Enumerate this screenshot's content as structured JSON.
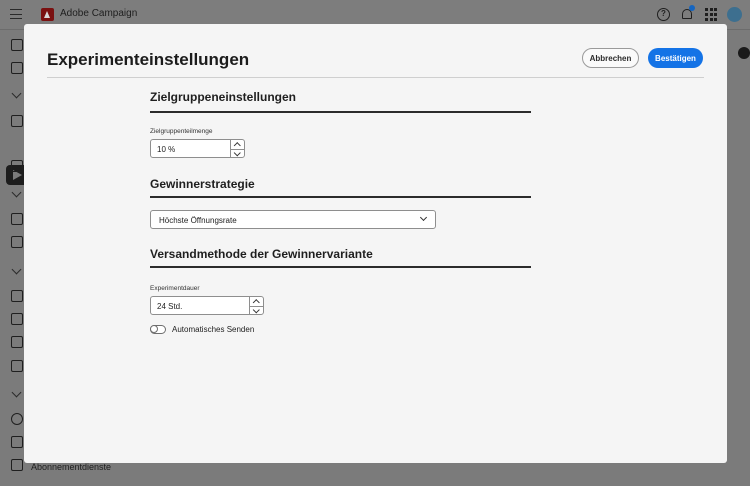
{
  "app": {
    "title": "Adobe Campaign"
  },
  "background": {
    "sidebar_last_item": "Abonnementdienste"
  },
  "modal": {
    "title": "Experimenteinstellungen",
    "cancel_label": "Abbrechen",
    "confirm_label": "Bestätigen",
    "sections": {
      "audience": {
        "title": "Zielgruppeneinstellungen",
        "field_label": "Zielgruppenteilmenge",
        "field_value": "10 %"
      },
      "winner": {
        "title": "Gewinnerstrategie",
        "dropdown_value": "Höchste Öffnungsrate"
      },
      "delivery": {
        "title": "Versandmethode der Gewinnervariante",
        "field_label": "Experimentdauer",
        "field_value": "24 Std.",
        "toggle_label": "Automatisches Senden",
        "toggle_on": false
      }
    }
  },
  "colors": {
    "accent": "#1473e6",
    "overlay": "#7b7b7b",
    "logo": "#7a1010"
  },
  "icons": [
    "menu-icon",
    "adobe-logo-icon",
    "help-icon",
    "notification-bell-icon",
    "app-switcher-icon",
    "avatar"
  ]
}
